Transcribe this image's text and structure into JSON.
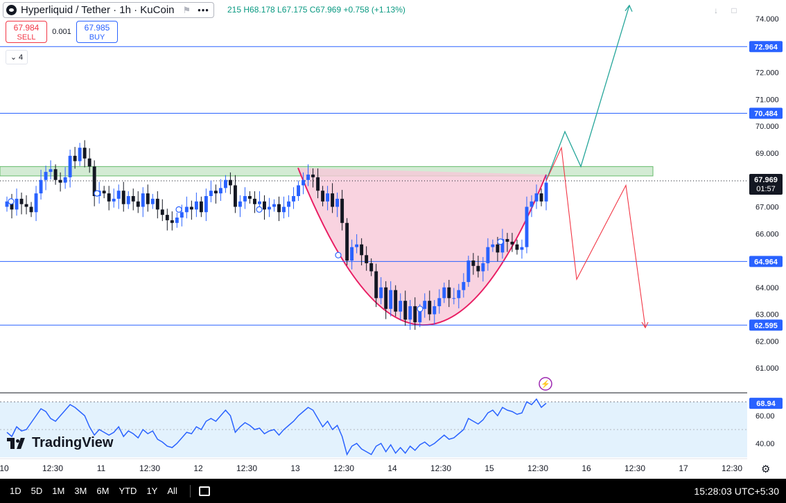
{
  "header": {
    "symbol": "Hyperliquid / Tether · 1h · KuCoin",
    "flag_icon": "flag-icon",
    "more_icon": "more-dots-icon",
    "ohlc": "215  H68.178  L67.175  C67.969  +0.758 (+1.13%)",
    "sell_price": "67.984",
    "sell_label": "SELL",
    "spread": "0.001",
    "buy_price": "67.985",
    "buy_label": "BUY",
    "indicators_count": "4"
  },
  "brand": {
    "name": "TradingView"
  },
  "toolbar": {
    "ranges": [
      "1D",
      "5D",
      "1M",
      "3M",
      "6M",
      "YTD",
      "1Y",
      "All"
    ],
    "calendar_icon": "calendar-icon",
    "time": "15:28:03 UTC+5:30"
  },
  "colors": {
    "up": "#2962ff",
    "down": "#131722",
    "cup_fill": "#f8c8d8",
    "cup_line": "#e91e63",
    "zone": "#c8e6c9",
    "level": "#2962ff",
    "path_up": "#26a69a",
    "path_down": "#f23645",
    "rsi_line": "#2962ff",
    "rsi_band": "#e3f2fd"
  },
  "chart_data": {
    "type": "candlestick",
    "symbol": "HYPEUSDT",
    "timeframe": "1h",
    "last_price": 67.969,
    "countdown": "01:57",
    "y_ticks": [
      74,
      73,
      72,
      71,
      70,
      69,
      68,
      67,
      66,
      65,
      64,
      63,
      62,
      61
    ],
    "ylim": [
      60.1,
      74.7
    ],
    "x_ticks": [
      "10",
      "12:30",
      "11",
      "12:30",
      "12",
      "12:30",
      "13",
      "12:30",
      "14",
      "12:30",
      "15",
      "12:30",
      "16",
      "12:30",
      "17",
      "12:30"
    ],
    "horizontal_levels": [
      72.964,
      70.484,
      64.964,
      62.595
    ],
    "resistance_zone": [
      68.15,
      68.5
    ],
    "cup_pattern": {
      "start": 68.45,
      "bottom": 62.6,
      "end": 68.2
    },
    "projections": {
      "bullish": [
        67.969,
        69.8,
        68.5,
        74.5
      ],
      "bearish": [
        67.969,
        69.2,
        64.3,
        67.8,
        62.5
      ]
    },
    "closes": [
      67.2,
      66.9,
      67.3,
      67.1,
      67.0,
      66.8,
      67.5,
      68.0,
      68.3,
      68.4,
      68.0,
      67.9,
      68.1,
      68.9,
      68.7,
      69.2,
      68.8,
      68.5,
      67.4,
      67.6,
      67.5,
      67.2,
      67.3,
      67.6,
      67.1,
      67.4,
      67.2,
      67.0,
      67.5,
      67.1,
      67.3,
      66.9,
      66.7,
      66.5,
      66.4,
      66.6,
      66.8,
      67.0,
      66.9,
      67.2,
      66.8,
      67.4,
      67.6,
      67.5,
      67.7,
      68.0,
      67.8,
      67.0,
      67.2,
      67.4,
      67.3,
      67.1,
      67.2,
      66.9,
      67.0,
      67.1,
      66.8,
      67.0,
      67.2,
      67.4,
      67.8,
      68.0,
      68.2,
      68.1,
      67.6,
      67.2,
      67.5,
      67.0,
      67.3,
      66.4,
      65.0,
      65.5,
      65.6,
      65.2,
      64.9,
      64.6,
      63.6,
      64.0,
      63.2,
      63.9,
      63.1,
      63.5,
      62.8,
      63.3,
      62.7,
      63.2,
      63.5,
      63.0,
      63.3,
      63.6,
      64.0,
      63.6,
      63.6,
      63.9,
      64.2,
      65.0,
      64.8,
      64.6,
      64.9,
      65.5,
      65.6,
      65.3,
      65.8,
      65.7,
      65.6,
      65.4,
      65.5,
      67.0,
      67.2,
      67.5,
      67.2,
      67.9
    ],
    "rsi": {
      "value": 68.94,
      "y_ticks": [
        60,
        40
      ],
      "ylim": [
        30,
        75
      ],
      "band": [
        30,
        70
      ],
      "values": [
        48,
        45,
        52,
        49,
        50,
        55,
        60,
        65,
        63,
        58,
        56,
        60,
        64,
        68,
        66,
        63,
        60,
        52,
        46,
        50,
        48,
        46,
        48,
        52,
        45,
        49,
        47,
        44,
        50,
        47,
        49,
        43,
        41,
        38,
        37,
        40,
        44,
        48,
        47,
        52,
        50,
        56,
        58,
        56,
        60,
        64,
        60,
        48,
        52,
        55,
        53,
        50,
        51,
        47,
        49,
        50,
        46,
        50,
        53,
        56,
        60,
        63,
        66,
        64,
        58,
        52,
        56,
        50,
        53,
        45,
        32,
        38,
        40,
        36,
        34,
        32,
        38,
        40,
        34,
        39,
        33,
        37,
        33,
        38,
        35,
        39,
        41,
        38,
        40,
        43,
        46,
        43,
        44,
        47,
        50,
        58,
        56,
        54,
        57,
        62,
        64,
        60,
        66,
        64,
        63,
        61,
        62,
        70,
        68,
        72,
        66,
        69
      ]
    }
  }
}
